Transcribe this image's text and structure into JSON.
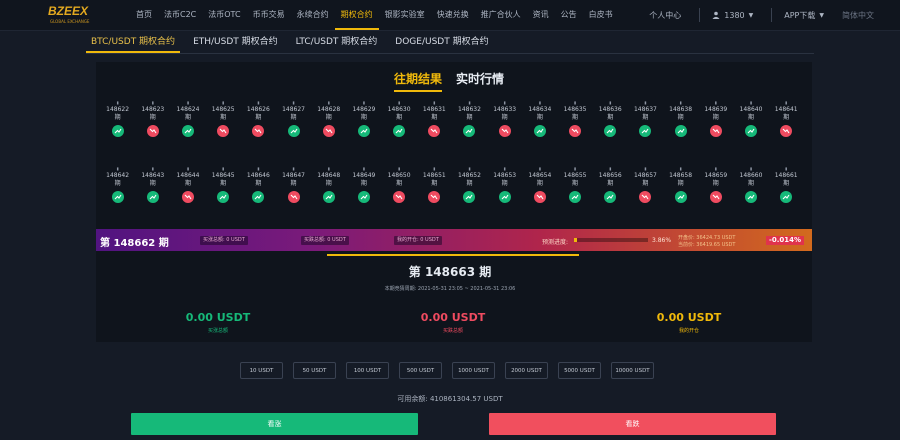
{
  "brand": {
    "logo_text": "BZEEX",
    "logo_sub": "GLOBAL EXCHANGE",
    "color": "#f0b90b"
  },
  "nav": {
    "items": [
      "首页",
      "法币C2C",
      "法币OTC",
      "币币交易",
      "永续合约",
      "期权合约",
      "银影实验室",
      "快速兑换",
      "推广合伙人",
      "资讯",
      "公告",
      "白皮书"
    ],
    "active_index": 5
  },
  "nav_right": {
    "user_center": "个人中心",
    "account": "1380",
    "app_download": "APP下载",
    "language": "简体中文"
  },
  "contract_tabs": {
    "items": [
      "BTC/USDT 期权合约",
      "ETH/USDT 期权合约",
      "LTC/USDT 期权合约",
      "DOGE/USDT 期权合约"
    ],
    "active_index": 0
  },
  "switch": {
    "history": "往期结果",
    "live": "实时行情",
    "active": "history"
  },
  "periods": {
    "row1": [
      {
        "no": "148622",
        "unit": "期",
        "trend": "up"
      },
      {
        "no": "148623",
        "unit": "期",
        "trend": "down"
      },
      {
        "no": "148624",
        "unit": "期",
        "trend": "up"
      },
      {
        "no": "148625",
        "unit": "期",
        "trend": "down"
      },
      {
        "no": "148626",
        "unit": "期",
        "trend": "down"
      },
      {
        "no": "148627",
        "unit": "期",
        "trend": "up"
      },
      {
        "no": "148628",
        "unit": "期",
        "trend": "down"
      },
      {
        "no": "148629",
        "unit": "期",
        "trend": "up"
      },
      {
        "no": "148630",
        "unit": "期",
        "trend": "up"
      },
      {
        "no": "148631",
        "unit": "期",
        "trend": "down"
      },
      {
        "no": "148632",
        "unit": "期",
        "trend": "up"
      },
      {
        "no": "148633",
        "unit": "期",
        "trend": "down"
      },
      {
        "no": "148634",
        "unit": "期",
        "trend": "up"
      },
      {
        "no": "148635",
        "unit": "期",
        "trend": "down"
      },
      {
        "no": "148636",
        "unit": "期",
        "trend": "up"
      },
      {
        "no": "148637",
        "unit": "期",
        "trend": "up"
      },
      {
        "no": "148638",
        "unit": "期",
        "trend": "up"
      },
      {
        "no": "148639",
        "unit": "期",
        "trend": "down"
      },
      {
        "no": "148640",
        "unit": "期",
        "trend": "up"
      },
      {
        "no": "148641",
        "unit": "期",
        "trend": "down"
      }
    ],
    "row2": [
      {
        "no": "148642",
        "unit": "期",
        "trend": "up"
      },
      {
        "no": "148643",
        "unit": "期",
        "trend": "up"
      },
      {
        "no": "148644",
        "unit": "期",
        "trend": "down"
      },
      {
        "no": "148645",
        "unit": "期",
        "trend": "up"
      },
      {
        "no": "148646",
        "unit": "期",
        "trend": "up"
      },
      {
        "no": "148647",
        "unit": "期",
        "trend": "down"
      },
      {
        "no": "148648",
        "unit": "期",
        "trend": "up"
      },
      {
        "no": "148649",
        "unit": "期",
        "trend": "up"
      },
      {
        "no": "148650",
        "unit": "期",
        "trend": "down"
      },
      {
        "no": "148651",
        "unit": "期",
        "trend": "down"
      },
      {
        "no": "148652",
        "unit": "期",
        "trend": "up"
      },
      {
        "no": "148653",
        "unit": "期",
        "trend": "up"
      },
      {
        "no": "148654",
        "unit": "期",
        "trend": "down"
      },
      {
        "no": "148655",
        "unit": "期",
        "trend": "up"
      },
      {
        "no": "148656",
        "unit": "期",
        "trend": "up"
      },
      {
        "no": "148657",
        "unit": "期",
        "trend": "down"
      },
      {
        "no": "148658",
        "unit": "期",
        "trend": "up"
      },
      {
        "no": "148659",
        "unit": "期",
        "trend": "down"
      },
      {
        "no": "148660",
        "unit": "期",
        "trend": "up"
      },
      {
        "no": "148661",
        "unit": "期",
        "trend": "up"
      }
    ]
  },
  "current": {
    "label": "第 148662 期",
    "buy_up": "买涨总额: 0 USDT",
    "buy_down": "买跌总额: 0 USDT",
    "my_pos": "我的开仓: 0 USDT",
    "progress_label": "预测进度:",
    "progress_fraction": 0.0386,
    "progress_text": "3.86%",
    "price_open": "开盘价: 36424.73 USDT",
    "price_current": "当前价: 36419.65 USDT",
    "change": "-0.014%"
  },
  "next": {
    "title": "第 148663 期",
    "time": "本期竞猜周期: 2021-05-31 23:05 ~ 2021-05-31 23:06",
    "buy_up_val": "0.00 USDT",
    "buy_up_label": "买涨总额",
    "buy_down_val": "0.00 USDT",
    "buy_down_label": "买跌总额",
    "mine_val": "0.00 USDT",
    "mine_label": "我的开仓",
    "colors": {
      "up": "#16b979",
      "down": "#ef4b60",
      "mine": "#f0b90b"
    }
  },
  "amounts": [
    "10 USDT",
    "50 USDT",
    "100 USDT",
    "500 USDT",
    "1000 USDT",
    "2000 USDT",
    "5000 USDT",
    "10000 USDT"
  ],
  "balance": "可用余额: 410861304.57 USDT",
  "actions": {
    "up": "看涨",
    "down": "看跌"
  }
}
